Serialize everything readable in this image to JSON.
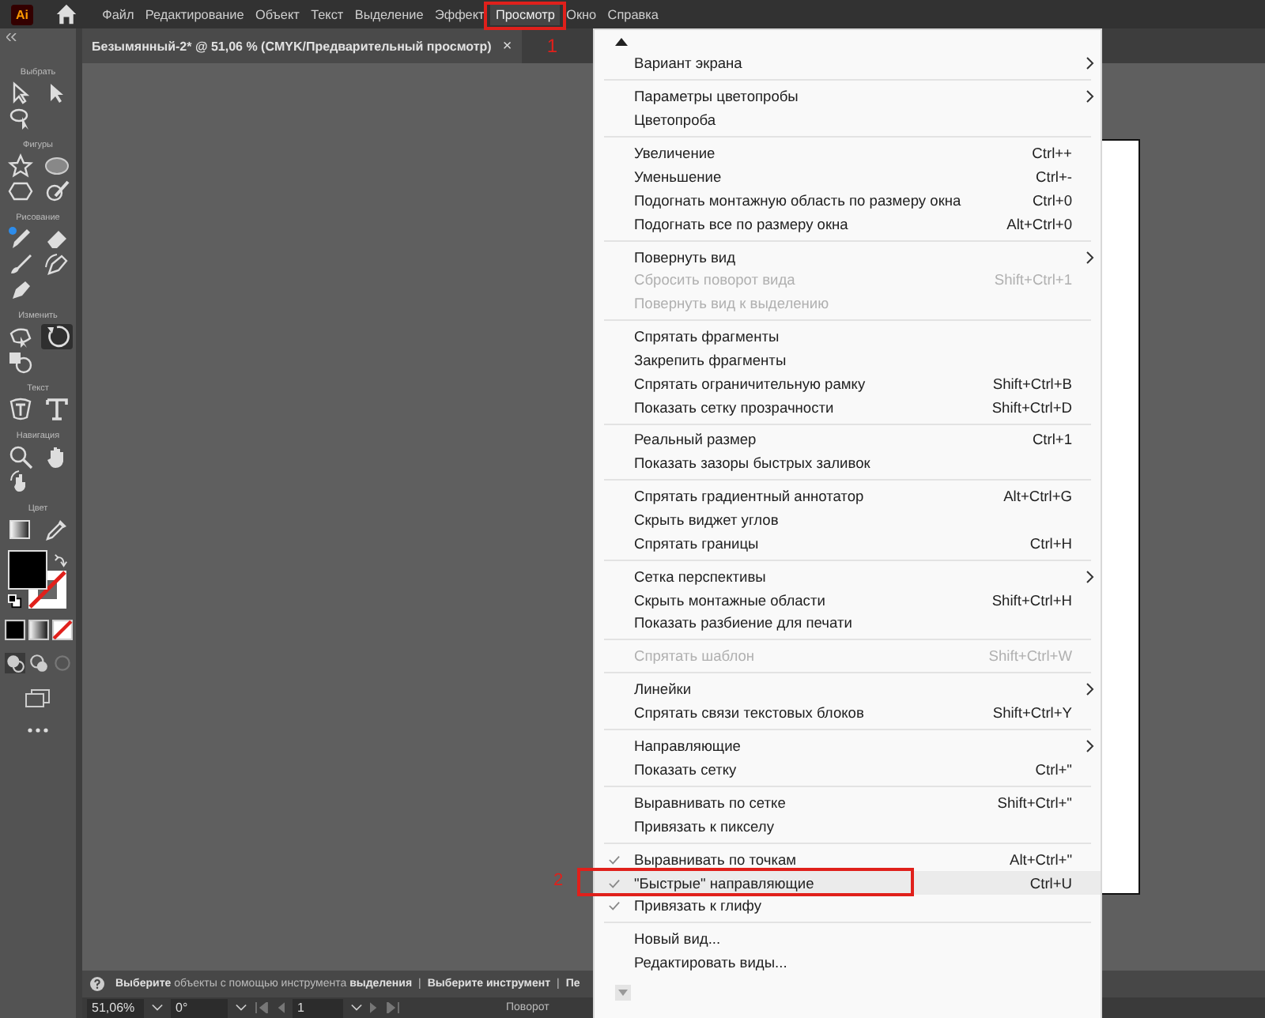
{
  "app": {
    "logo": "Ai"
  },
  "menu_bar": [
    {
      "label": "Файл",
      "selected": false
    },
    {
      "label": "Редактирование",
      "selected": false
    },
    {
      "label": "Объект",
      "selected": false
    },
    {
      "label": "Текст",
      "selected": false
    },
    {
      "label": "Выделение",
      "selected": false
    },
    {
      "label": "Эффект",
      "selected": false
    },
    {
      "label": "Просмотр",
      "selected": true,
      "annotation": "1"
    },
    {
      "label": "Окно",
      "selected": false
    },
    {
      "label": "Справка",
      "selected": false
    }
  ],
  "document_tab": {
    "title": "Безымянный-2* @ 51,06 % (CMYK/Предварительный просмотр)",
    "close": "×"
  },
  "toolbar": {
    "sections": [
      {
        "title": "Выбрать",
        "tools": [
          {
            "selected": false
          },
          {
            "selected": false
          },
          {
            "selected": false
          }
        ]
      },
      {
        "title": "Фигуры",
        "tools": [
          {
            "selected": false
          },
          {
            "selected": false
          },
          {
            "selected": false
          },
          {
            "selected": false
          }
        ]
      },
      {
        "title": "Рисование",
        "tools": [
          {
            "selected": false
          },
          {
            "selected": false
          },
          {
            "selected": false
          },
          {
            "selected": false
          },
          {
            "selected": false
          }
        ]
      },
      {
        "title": "Изменить",
        "tools": [
          {
            "selected": false
          },
          {
            "selected": true
          },
          {
            "selected": false
          }
        ]
      },
      {
        "title": "Текст",
        "tools": [
          {
            "selected": false
          },
          {
            "selected": false
          }
        ]
      },
      {
        "title": "Навигация",
        "tools": [
          {
            "selected": false
          },
          {
            "selected": false
          },
          {
            "selected": false
          }
        ]
      },
      {
        "title": "Цвет",
        "tools": [
          {
            "selected": false
          },
          {
            "selected": false
          }
        ]
      }
    ]
  },
  "view_menu": {
    "groups": [
      [
        {
          "label": "Вариант экрана",
          "submenu": true,
          "disabled": false,
          "checked": false,
          "selected": false
        }
      ],
      [
        {
          "label": "Параметры цветопробы",
          "submenu": true,
          "disabled": false,
          "checked": false,
          "selected": false
        },
        {
          "label": "Цветопроба",
          "submenu": false,
          "disabled": false,
          "checked": false,
          "selected": false
        }
      ],
      [
        {
          "label": "Увеличение",
          "shortcut": "Ctrl++",
          "submenu": false,
          "disabled": false,
          "checked": false,
          "selected": false
        },
        {
          "label": "Уменьшение",
          "shortcut": "Ctrl+-",
          "submenu": false,
          "disabled": false,
          "checked": false,
          "selected": false
        },
        {
          "label": "Подогнать монтажную область по размеру окна",
          "shortcut": "Ctrl+0",
          "submenu": false,
          "disabled": false,
          "checked": false,
          "selected": false
        },
        {
          "label": "Подогнать все по размеру окна",
          "shortcut": "Alt+Ctrl+0",
          "submenu": false,
          "disabled": false,
          "checked": false,
          "selected": false
        }
      ],
      [
        {
          "label": "Повернуть вид",
          "submenu": true,
          "disabled": false,
          "checked": false,
          "selected": false
        },
        {
          "label": "Сбросить поворот вида",
          "shortcut": "Shift+Ctrl+1",
          "submenu": false,
          "disabled": true,
          "checked": false,
          "selected": false
        },
        {
          "label": "Повернуть вид к выделению",
          "submenu": false,
          "disabled": true,
          "checked": false,
          "selected": false
        }
      ],
      [
        {
          "label": "Спрятать фрагменты",
          "submenu": false,
          "disabled": false,
          "checked": false,
          "selected": false
        },
        {
          "label": "Закрепить фрагменты",
          "submenu": false,
          "disabled": false,
          "checked": false,
          "selected": false
        },
        {
          "label": "Спрятать ограничительную рамку",
          "shortcut": "Shift+Ctrl+B",
          "submenu": false,
          "disabled": false,
          "checked": false,
          "selected": false
        },
        {
          "label": "Показать сетку прозрачности",
          "shortcut": "Shift+Ctrl+D",
          "submenu": false,
          "disabled": false,
          "checked": false,
          "selected": false
        }
      ],
      [
        {
          "label": "Реальный размер",
          "shortcut": "Ctrl+1",
          "submenu": false,
          "disabled": false,
          "checked": false,
          "selected": false
        },
        {
          "label": "Показать зазоры быстрых заливок",
          "submenu": false,
          "disabled": false,
          "checked": false,
          "selected": false
        }
      ],
      [
        {
          "label": "Спрятать градиентный аннотатор",
          "shortcut": "Alt+Ctrl+G",
          "submenu": false,
          "disabled": false,
          "checked": false,
          "selected": false
        },
        {
          "label": "Скрыть виджет углов",
          "submenu": false,
          "disabled": false,
          "checked": false,
          "selected": false
        },
        {
          "label": "Спрятать границы",
          "shortcut": "Ctrl+H",
          "submenu": false,
          "disabled": false,
          "checked": false,
          "selected": false
        }
      ],
      [
        {
          "label": "Сетка перспективы",
          "submenu": true,
          "disabled": false,
          "checked": false,
          "selected": false
        },
        {
          "label": "Скрыть монтажные области",
          "shortcut": "Shift+Ctrl+H",
          "submenu": false,
          "disabled": false,
          "checked": false,
          "selected": false
        },
        {
          "label": "Показать разбиение для печати",
          "submenu": false,
          "disabled": false,
          "checked": false,
          "selected": false
        }
      ],
      [
        {
          "label": "Спрятать шаблон",
          "shortcut": "Shift+Ctrl+W",
          "submenu": false,
          "disabled": true,
          "checked": false,
          "selected": false
        }
      ],
      [
        {
          "label": "Линейки",
          "submenu": true,
          "disabled": false,
          "checked": false,
          "selected": false
        },
        {
          "label": "Спрятать связи текстовых блоков",
          "shortcut": "Shift+Ctrl+Y",
          "submenu": false,
          "disabled": false,
          "checked": false,
          "selected": false
        }
      ],
      [
        {
          "label": "Направляющие",
          "submenu": true,
          "disabled": false,
          "checked": false,
          "selected": false
        },
        {
          "label": "Показать сетку",
          "shortcut": "Ctrl+\"",
          "submenu": false,
          "disabled": false,
          "checked": false,
          "selected": false
        }
      ],
      [
        {
          "label": "Выравнивать по сетке",
          "shortcut": "Shift+Ctrl+\"",
          "submenu": false,
          "disabled": false,
          "checked": false,
          "selected": false
        },
        {
          "label": "Привязать к пикселу",
          "submenu": false,
          "disabled": false,
          "checked": false,
          "selected": false
        }
      ],
      [
        {
          "label": "Выравнивать по точкам",
          "shortcut": "Alt+Ctrl+\"",
          "submenu": false,
          "disabled": false,
          "checked": true,
          "selected": false
        },
        {
          "label": "\"Быстрые\" направляющие",
          "shortcut": "Ctrl+U",
          "submenu": false,
          "disabled": false,
          "checked": true,
          "selected": true,
          "annotation": "2"
        },
        {
          "label": "Привязать к глифу",
          "submenu": false,
          "disabled": false,
          "checked": true,
          "selected": false
        }
      ],
      [
        {
          "label": "Новый вид...",
          "submenu": false,
          "disabled": false,
          "checked": false,
          "selected": false
        },
        {
          "label": "Редактировать виды...",
          "submenu": false,
          "disabled": false,
          "checked": false,
          "selected": false
        }
      ]
    ]
  },
  "status_bar": {
    "hint": "**Выберите** объекты с помощью инструмента **выделения**",
    "separator_1": "|",
    "tool": "Выберите инструмент",
    "separator_2": "|",
    "extra": "Пе"
  },
  "bottom_bar": {
    "zoom": "51,06%",
    "rotation": "0°",
    "artboard": "1",
    "rotate_label": "Поворот"
  }
}
